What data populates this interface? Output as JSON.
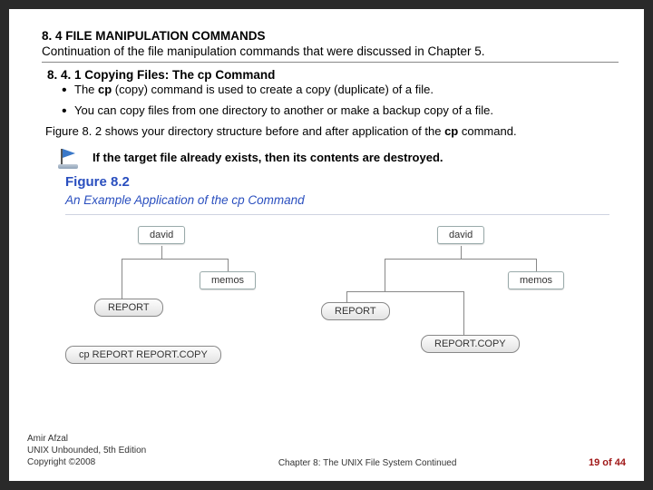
{
  "header": {
    "section_number": "8. 4 FILE MANIPULATION COMMANDS",
    "continuation": "Continuation of the file manipulation commands that were discussed in Chapter 5."
  },
  "subsection": {
    "title_prefix": "8. 4. 1 Copying Files: The ",
    "cmd": "cp",
    "title_suffix": " Command",
    "bullets": [
      {
        "pre": "The ",
        "b": "cp",
        "post": " (copy) command is used to create a copy (duplicate) of a file."
      },
      {
        "pre": "",
        "b": "",
        "post": "You can copy files from one directory to another or make a backup copy of a file."
      }
    ]
  },
  "para": {
    "pre": "Figure 8. 2 shows your directory structure before and after application of the ",
    "b": "cp",
    "post": " command."
  },
  "warning": "If the target file already exists, then its contents are destroyed.",
  "figure": {
    "label": "Figure 8.2",
    "title": "An Example Application of the cp Command",
    "node_david": "david",
    "node_memos": "memos",
    "file_report": "REPORT",
    "file_copy": "REPORT.COPY",
    "cmd_line": "cp REPORT REPORT.COPY"
  },
  "footer": {
    "author": "Amir Afzal",
    "book": "UNIX Unbounded, 5th Edition",
    "copyright": "Copyright ©2008",
    "chapter": "Chapter 8: The UNIX File System Continued",
    "page_cur": "19",
    "page_sep": " of ",
    "page_tot": "44"
  }
}
